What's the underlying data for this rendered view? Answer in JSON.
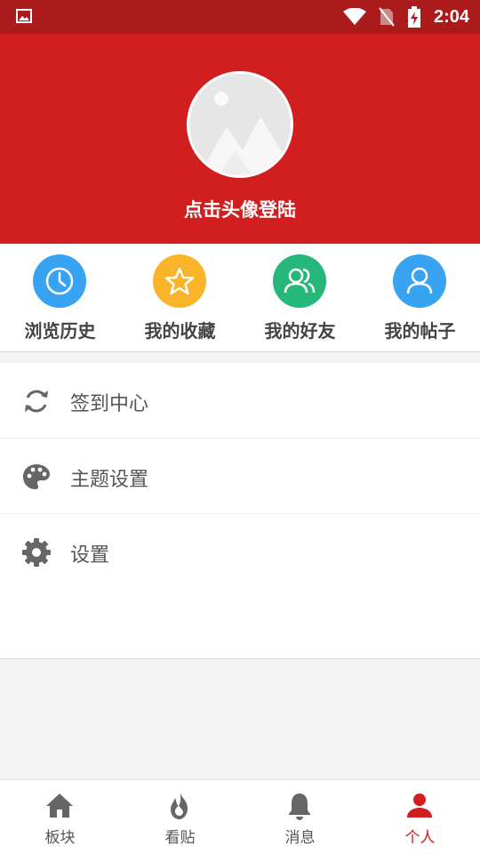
{
  "status_bar": {
    "time": "2:04",
    "icons": [
      "image-icon",
      "wifi-icon",
      "no-sim-icon",
      "battery-charging-icon"
    ]
  },
  "header": {
    "avatar_icon": "image-placeholder-icon",
    "login_text": "点击头像登陆",
    "background_color": "#d11f20"
  },
  "quick_actions": [
    {
      "label": "浏览历史",
      "icon": "clock-icon",
      "color": "#38a3f1"
    },
    {
      "label": "我的收藏",
      "icon": "star-icon",
      "color": "#f9b429"
    },
    {
      "label": "我的好友",
      "icon": "friends-icon",
      "color": "#26b77a"
    },
    {
      "label": "我的帖子",
      "icon": "user-icon",
      "color": "#38a3f1"
    }
  ],
  "menu": [
    {
      "label": "签到中心",
      "icon": "sync-icon"
    },
    {
      "label": "主题设置",
      "icon": "palette-icon"
    },
    {
      "label": "设置",
      "icon": "gear-icon"
    }
  ],
  "tabbar": {
    "active_index": 3,
    "active_color": "#d11f20",
    "items": [
      {
        "label": "板块",
        "icon": "home-icon"
      },
      {
        "label": "看贴",
        "icon": "flame-icon"
      },
      {
        "label": "消息",
        "icon": "bell-icon"
      },
      {
        "label": "个人",
        "icon": "person-icon"
      }
    ]
  }
}
